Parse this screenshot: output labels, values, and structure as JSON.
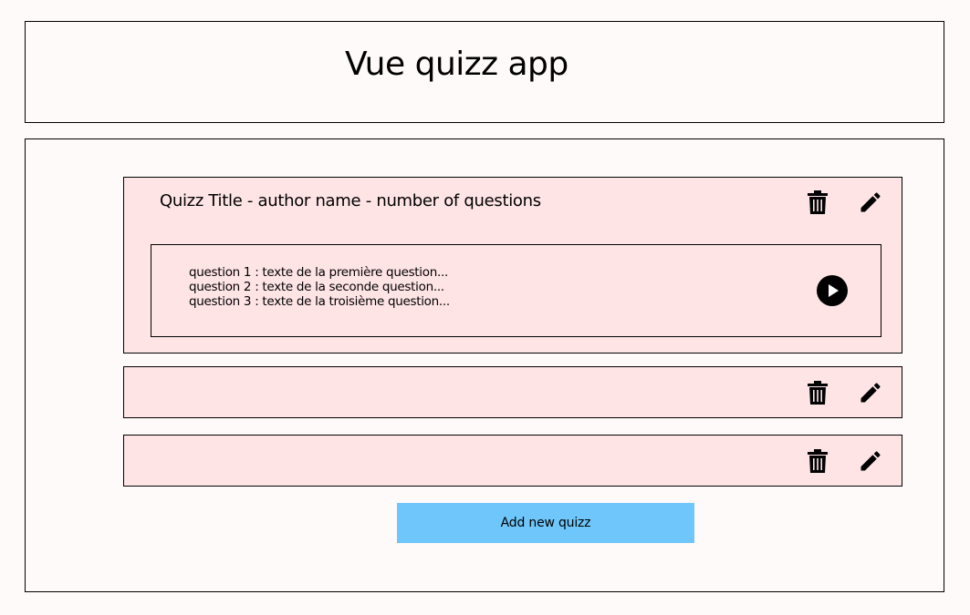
{
  "header": {
    "title": "Vue quizz app"
  },
  "quizzes": [
    {
      "title": "Quizz Title - author name - number of questions",
      "expanded": true,
      "questions": [
        "question 1 : texte de la première question...",
        "question 2 : texte de la seconde question...",
        "question 3 : texte de la troisième question..."
      ],
      "icons": {
        "delete": "trash-icon",
        "edit": "pencil-icon",
        "play": "play-circle-icon"
      }
    },
    {
      "title": "",
      "expanded": false,
      "icons": {
        "delete": "trash-icon",
        "edit": "pencil-icon"
      }
    },
    {
      "title": "",
      "expanded": false,
      "icons": {
        "delete": "trash-icon",
        "edit": "pencil-icon"
      }
    }
  ],
  "actions": {
    "add_label": "Add new quizz"
  },
  "colors": {
    "page_background": "#fffafa",
    "card_background": "#ffe4e6",
    "add_button": "#6ec6fb",
    "border": "#000000"
  }
}
